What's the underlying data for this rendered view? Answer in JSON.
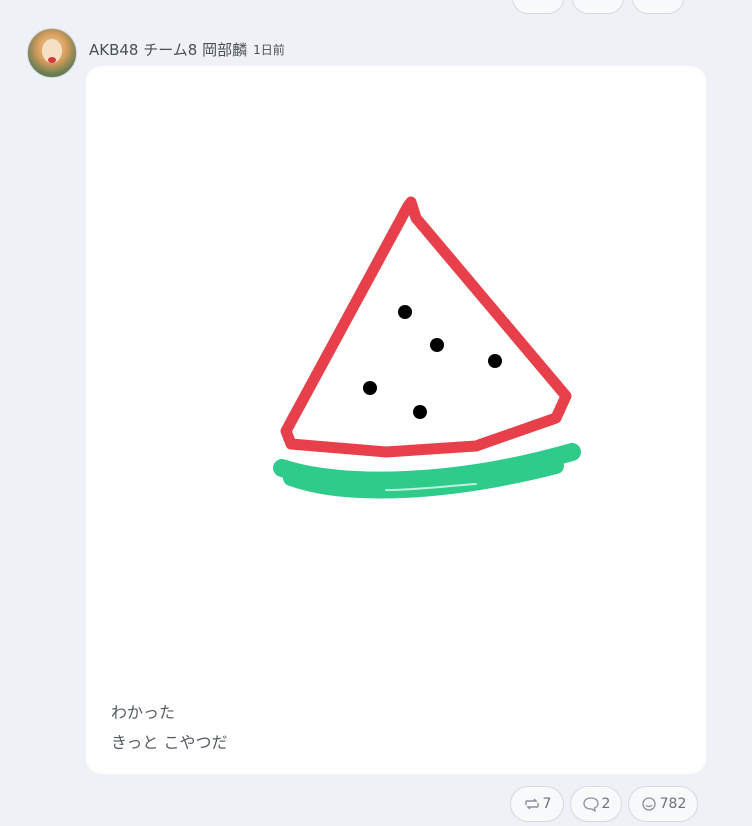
{
  "post": {
    "author": "AKB48 チーム8 岡部麟",
    "time": "1日前",
    "caption_line1": "わかった",
    "caption_line2": "きっと こやつだ"
  },
  "actions": {
    "repost_count": "7",
    "reply_count": "2",
    "like_count": "782"
  },
  "icons": {
    "repost": "repost-icon",
    "reply": "comment-icon",
    "like": "like-icon"
  },
  "colors": {
    "background": "#eef1f5",
    "card": "#ffffff",
    "watermelon_rind": "#e8404a",
    "watermelon_green": "#2ecb8a",
    "seeds": "#000000"
  }
}
